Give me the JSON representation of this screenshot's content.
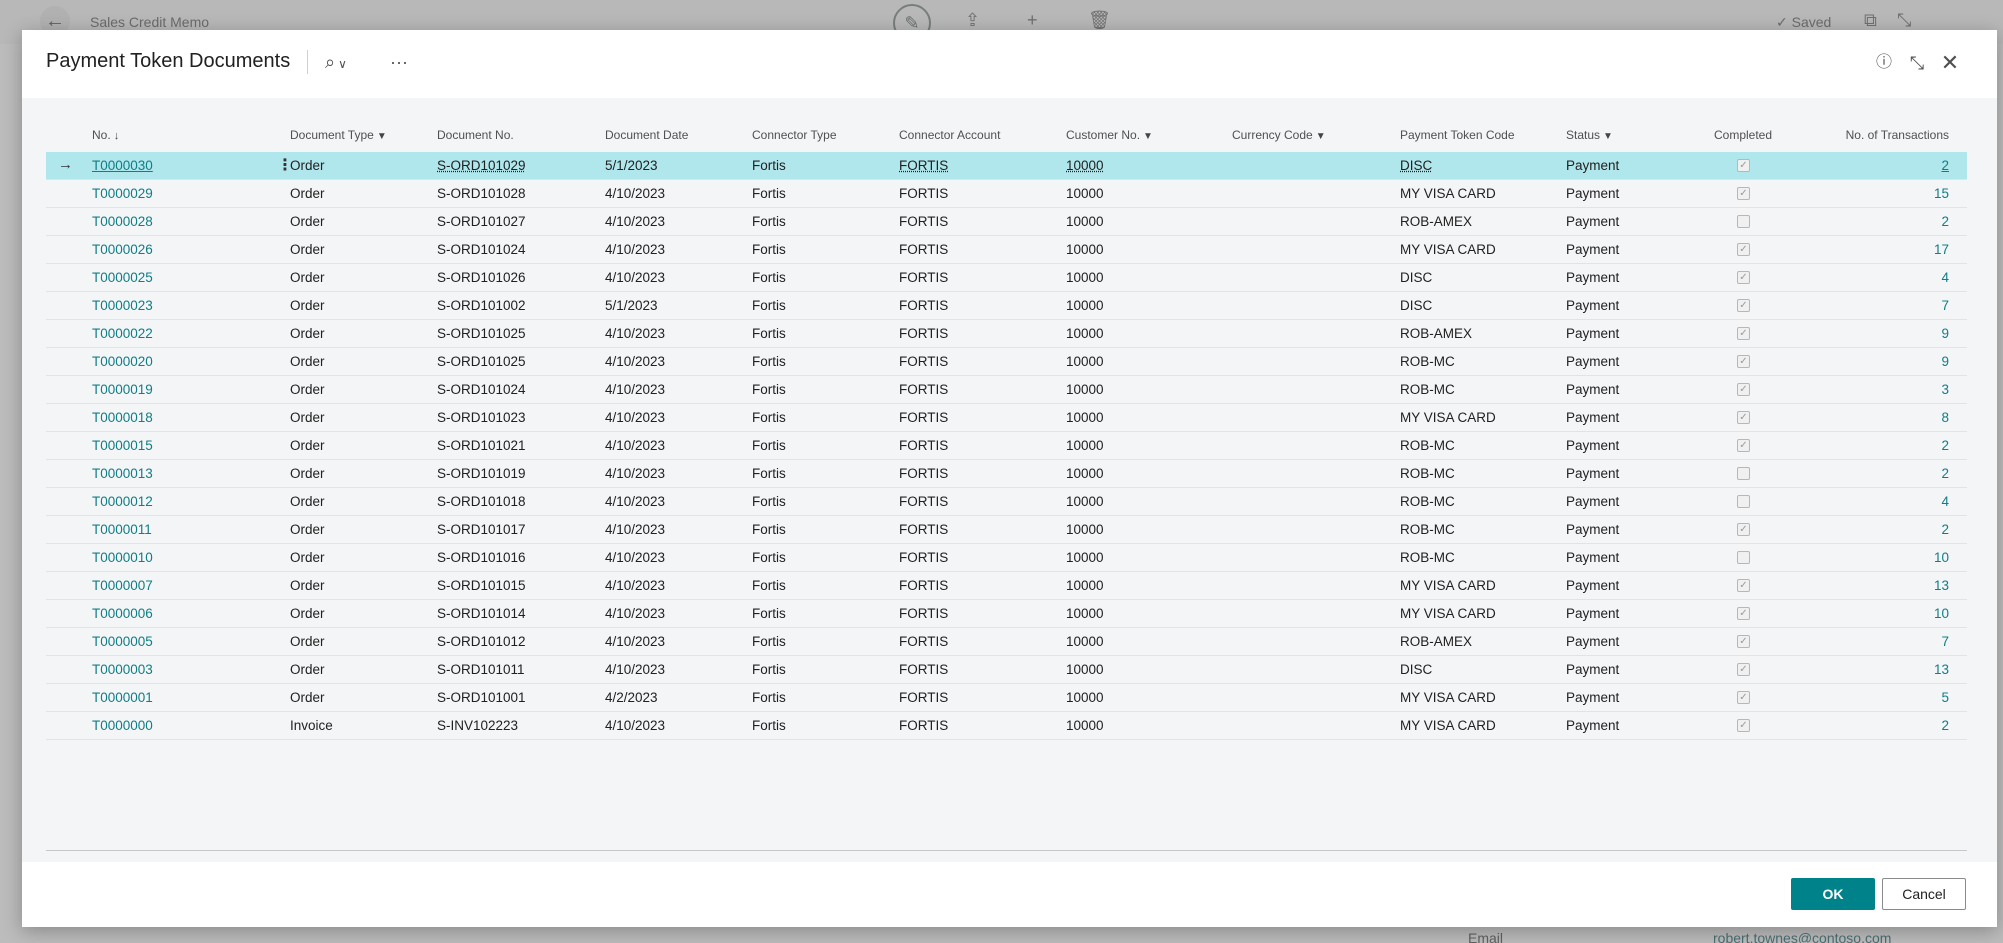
{
  "background": {
    "page_title": "Sales Credit Memo",
    "saved_label": "Saved",
    "email_label": "Email",
    "email_value": "robert.townes@contoso.com"
  },
  "dialog": {
    "title": "Payment Token Documents",
    "ok_label": "OK",
    "cancel_label": "Cancel"
  },
  "columns": [
    {
      "label": "No.",
      "sort": "↓"
    },
    {
      "label": "Document Type",
      "filter": true
    },
    {
      "label": "Document No."
    },
    {
      "label": "Document Date"
    },
    {
      "label": "Connector Type"
    },
    {
      "label": "Connector Account"
    },
    {
      "label": "Customer No.",
      "filter": true
    },
    {
      "label": "Currency Code",
      "filter": true
    },
    {
      "label": "Payment Token Code"
    },
    {
      "label": "Status",
      "filter": true
    },
    {
      "label": "Completed"
    },
    {
      "label": "No. of Transactions"
    }
  ],
  "rows": [
    {
      "no": "T0000030",
      "doc_type": "Order",
      "doc_no": "S-ORD101029",
      "date": "5/1/2023",
      "conn_type": "Fortis",
      "conn_acct": "FORTIS",
      "cust_no": "10000",
      "currency": "",
      "token": "DISC",
      "status": "Payment",
      "completed": true,
      "transactions": "2",
      "selected": true
    },
    {
      "no": "T0000029",
      "doc_type": "Order",
      "doc_no": "S-ORD101028",
      "date": "4/10/2023",
      "conn_type": "Fortis",
      "conn_acct": "FORTIS",
      "cust_no": "10000",
      "currency": "",
      "token": "MY VISA CARD",
      "status": "Payment",
      "completed": true,
      "transactions": "15"
    },
    {
      "no": "T0000028",
      "doc_type": "Order",
      "doc_no": "S-ORD101027",
      "date": "4/10/2023",
      "conn_type": "Fortis",
      "conn_acct": "FORTIS",
      "cust_no": "10000",
      "currency": "",
      "token": "ROB-AMEX",
      "status": "Payment",
      "completed": false,
      "transactions": "2"
    },
    {
      "no": "T0000026",
      "doc_type": "Order",
      "doc_no": "S-ORD101024",
      "date": "4/10/2023",
      "conn_type": "Fortis",
      "conn_acct": "FORTIS",
      "cust_no": "10000",
      "currency": "",
      "token": "MY VISA CARD",
      "status": "Payment",
      "completed": true,
      "transactions": "17"
    },
    {
      "no": "T0000025",
      "doc_type": "Order",
      "doc_no": "S-ORD101026",
      "date": "4/10/2023",
      "conn_type": "Fortis",
      "conn_acct": "FORTIS",
      "cust_no": "10000",
      "currency": "",
      "token": "DISC",
      "status": "Payment",
      "completed": true,
      "transactions": "4"
    },
    {
      "no": "T0000023",
      "doc_type": "Order",
      "doc_no": "S-ORD101002",
      "date": "5/1/2023",
      "conn_type": "Fortis",
      "conn_acct": "FORTIS",
      "cust_no": "10000",
      "currency": "",
      "token": "DISC",
      "status": "Payment",
      "completed": true,
      "transactions": "7"
    },
    {
      "no": "T0000022",
      "doc_type": "Order",
      "doc_no": "S-ORD101025",
      "date": "4/10/2023",
      "conn_type": "Fortis",
      "conn_acct": "FORTIS",
      "cust_no": "10000",
      "currency": "",
      "token": "ROB-AMEX",
      "status": "Payment",
      "completed": true,
      "transactions": "9"
    },
    {
      "no": "T0000020",
      "doc_type": "Order",
      "doc_no": "S-ORD101025",
      "date": "4/10/2023",
      "conn_type": "Fortis",
      "conn_acct": "FORTIS",
      "cust_no": "10000",
      "currency": "",
      "token": "ROB-MC",
      "status": "Payment",
      "completed": true,
      "transactions": "9"
    },
    {
      "no": "T0000019",
      "doc_type": "Order",
      "doc_no": "S-ORD101024",
      "date": "4/10/2023",
      "conn_type": "Fortis",
      "conn_acct": "FORTIS",
      "cust_no": "10000",
      "currency": "",
      "token": "ROB-MC",
      "status": "Payment",
      "completed": true,
      "transactions": "3"
    },
    {
      "no": "T0000018",
      "doc_type": "Order",
      "doc_no": "S-ORD101023",
      "date": "4/10/2023",
      "conn_type": "Fortis",
      "conn_acct": "FORTIS",
      "cust_no": "10000",
      "currency": "",
      "token": "MY VISA CARD",
      "status": "Payment",
      "completed": true,
      "transactions": "8"
    },
    {
      "no": "T0000015",
      "doc_type": "Order",
      "doc_no": "S-ORD101021",
      "date": "4/10/2023",
      "conn_type": "Fortis",
      "conn_acct": "FORTIS",
      "cust_no": "10000",
      "currency": "",
      "token": "ROB-MC",
      "status": "Payment",
      "completed": true,
      "transactions": "2"
    },
    {
      "no": "T0000013",
      "doc_type": "Order",
      "doc_no": "S-ORD101019",
      "date": "4/10/2023",
      "conn_type": "Fortis",
      "conn_acct": "FORTIS",
      "cust_no": "10000",
      "currency": "",
      "token": "ROB-MC",
      "status": "Payment",
      "completed": false,
      "transactions": "2"
    },
    {
      "no": "T0000012",
      "doc_type": "Order",
      "doc_no": "S-ORD101018",
      "date": "4/10/2023",
      "conn_type": "Fortis",
      "conn_acct": "FORTIS",
      "cust_no": "10000",
      "currency": "",
      "token": "ROB-MC",
      "status": "Payment",
      "completed": false,
      "transactions": "4"
    },
    {
      "no": "T0000011",
      "doc_type": "Order",
      "doc_no": "S-ORD101017",
      "date": "4/10/2023",
      "conn_type": "Fortis",
      "conn_acct": "FORTIS",
      "cust_no": "10000",
      "currency": "",
      "token": "ROB-MC",
      "status": "Payment",
      "completed": true,
      "transactions": "2"
    },
    {
      "no": "T0000010",
      "doc_type": "Order",
      "doc_no": "S-ORD101016",
      "date": "4/10/2023",
      "conn_type": "Fortis",
      "conn_acct": "FORTIS",
      "cust_no": "10000",
      "currency": "",
      "token": "ROB-MC",
      "status": "Payment",
      "completed": false,
      "transactions": "10"
    },
    {
      "no": "T0000007",
      "doc_type": "Order",
      "doc_no": "S-ORD101015",
      "date": "4/10/2023",
      "conn_type": "Fortis",
      "conn_acct": "FORTIS",
      "cust_no": "10000",
      "currency": "",
      "token": "MY VISA CARD",
      "status": "Payment",
      "completed": true,
      "transactions": "13"
    },
    {
      "no": "T0000006",
      "doc_type": "Order",
      "doc_no": "S-ORD101014",
      "date": "4/10/2023",
      "conn_type": "Fortis",
      "conn_acct": "FORTIS",
      "cust_no": "10000",
      "currency": "",
      "token": "MY VISA CARD",
      "status": "Payment",
      "completed": true,
      "transactions": "10"
    },
    {
      "no": "T0000005",
      "doc_type": "Order",
      "doc_no": "S-ORD101012",
      "date": "4/10/2023",
      "conn_type": "Fortis",
      "conn_acct": "FORTIS",
      "cust_no": "10000",
      "currency": "",
      "token": "ROB-AMEX",
      "status": "Payment",
      "completed": true,
      "transactions": "7"
    },
    {
      "no": "T0000003",
      "doc_type": "Order",
      "doc_no": "S-ORD101011",
      "date": "4/10/2023",
      "conn_type": "Fortis",
      "conn_acct": "FORTIS",
      "cust_no": "10000",
      "currency": "",
      "token": "DISC",
      "status": "Payment",
      "completed": true,
      "transactions": "13"
    },
    {
      "no": "T0000001",
      "doc_type": "Order",
      "doc_no": "S-ORD101001",
      "date": "4/2/2023",
      "conn_type": "Fortis",
      "conn_acct": "FORTIS",
      "cust_no": "10000",
      "currency": "",
      "token": "MY VISA CARD",
      "status": "Payment",
      "completed": true,
      "transactions": "5"
    },
    {
      "no": "T0000000",
      "doc_type": "Invoice",
      "doc_no": "S-INV102223",
      "date": "4/10/2023",
      "conn_type": "Fortis",
      "conn_acct": "FORTIS",
      "cust_no": "10000",
      "currency": "",
      "token": "MY VISA CARD",
      "status": "Payment",
      "completed": true,
      "transactions": "2"
    }
  ],
  "colors": {
    "accent": "#00828a",
    "link": "#0f7e85",
    "selected_row": "#b0e7ec"
  }
}
